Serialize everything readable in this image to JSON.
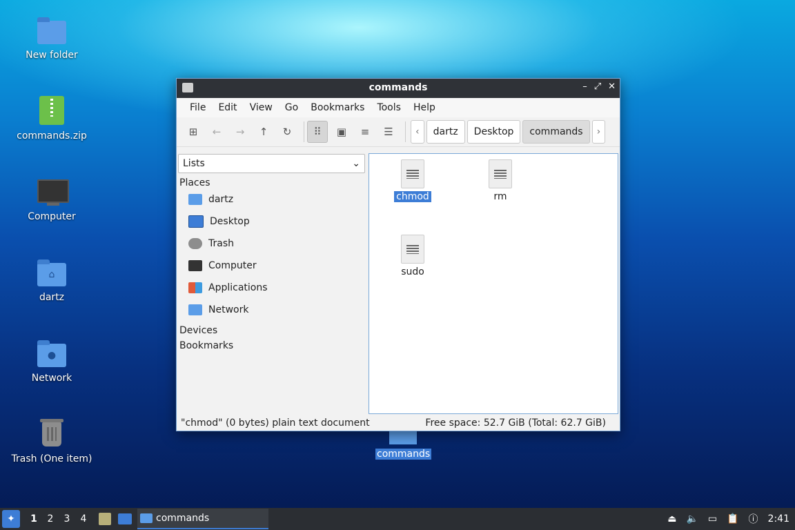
{
  "desktop": {
    "icons": [
      {
        "label": "New folder"
      },
      {
        "label": "commands.zip"
      },
      {
        "label": "Computer"
      },
      {
        "label": "dartz"
      },
      {
        "label": "Network"
      },
      {
        "label": "Trash (One item)"
      }
    ],
    "selected_folder": "commands"
  },
  "window": {
    "title": "commands",
    "menu": [
      "File",
      "Edit",
      "View",
      "Go",
      "Bookmarks",
      "Tools",
      "Help"
    ],
    "breadcrumb": [
      "dartz",
      "Desktop",
      "commands"
    ],
    "sidebar": {
      "view_mode": "Lists",
      "places_header": "Places",
      "places": [
        {
          "label": "dartz",
          "icon": "home-folder-icon"
        },
        {
          "label": "Desktop",
          "icon": "desktop-icon"
        },
        {
          "label": "Trash",
          "icon": "trash-icon"
        },
        {
          "label": "Computer",
          "icon": "computer-icon"
        },
        {
          "label": "Applications",
          "icon": "applications-icon"
        },
        {
          "label": "Network",
          "icon": "network-icon"
        }
      ],
      "devices_header": "Devices",
      "bookmarks_header": "Bookmarks"
    },
    "files": [
      {
        "name": "chmod",
        "selected": true
      },
      {
        "name": "rm",
        "selected": false
      },
      {
        "name": "sudo",
        "selected": false
      }
    ],
    "status": {
      "left": "\"chmod\" (0 bytes) plain text document",
      "right": "Free space: 52.7 GiB (Total: 62.7 GiB)"
    }
  },
  "taskbar": {
    "workspaces": [
      "1",
      "2",
      "3",
      "4"
    ],
    "task_label": "commands",
    "clock": "2:41"
  },
  "colors": {
    "accent": "#3d7dd6",
    "titlebar": "#2f3237",
    "taskbar": "#2b2e33"
  }
}
